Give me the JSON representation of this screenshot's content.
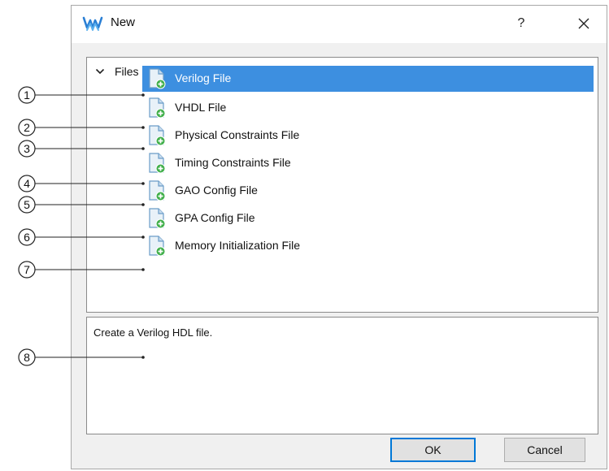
{
  "window": {
    "title": "New",
    "help_label": "?",
    "accent": "#3d8fe0"
  },
  "tree": {
    "group_label": "Files",
    "items": [
      {
        "label": "Verilog File",
        "selected": true
      },
      {
        "label": "VHDL File",
        "selected": false
      },
      {
        "label": "Physical Constraints File",
        "selected": false
      },
      {
        "label": "Timing Constraints File",
        "selected": false
      },
      {
        "label": "GAO Config File",
        "selected": false
      },
      {
        "label": "GPA Config File",
        "selected": false
      },
      {
        "label": "Memory Initialization File",
        "selected": false
      }
    ]
  },
  "description": {
    "text": "Create a Verilog HDL file."
  },
  "buttons": {
    "ok_label": "OK",
    "cancel_label": "Cancel"
  },
  "callouts": [
    "1",
    "2",
    "3",
    "4",
    "5",
    "6",
    "7",
    "8"
  ]
}
